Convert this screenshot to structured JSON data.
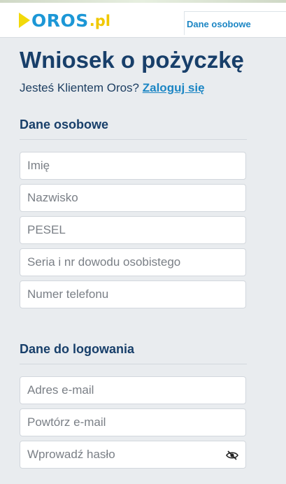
{
  "header": {
    "logo_text": "OROS",
    "logo_suffix": ".pl",
    "nav_label": "Dane osobowe"
  },
  "page": {
    "title": "Wniosek o pożyczkę",
    "login_prompt": "Jesteś Klientem Oros?",
    "login_link": "Zaloguj się"
  },
  "personal": {
    "heading": "Dane osobowe",
    "fields": [
      {
        "placeholder": "Imię"
      },
      {
        "placeholder": "Nazwisko"
      },
      {
        "placeholder": "PESEL"
      },
      {
        "placeholder": "Seria i nr dowodu osobistego"
      },
      {
        "placeholder": "Numer telefonu"
      }
    ]
  },
  "login": {
    "heading": "Dane do logowania",
    "fields": [
      {
        "placeholder": "Adres e-mail"
      },
      {
        "placeholder": "Powtórz e-mail"
      },
      {
        "placeholder": "Wprowadź hasło"
      }
    ]
  }
}
